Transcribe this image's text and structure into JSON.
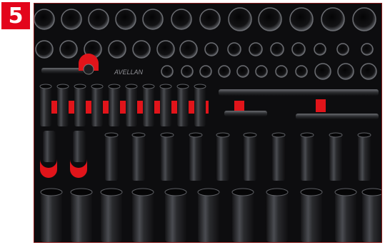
{
  "badge": {
    "number": "5",
    "color": "#e3051b"
  },
  "photo": {
    "subject": "tool-tray-with-impact-sockets-and-extension-bars",
    "colors": {
      "foam": "#0d0d0f",
      "insert": "#e1141a",
      "socket": "#2a2b2e",
      "socket_highlight": "#5a5c61"
    },
    "insert_marking": "AVELLAN"
  }
}
